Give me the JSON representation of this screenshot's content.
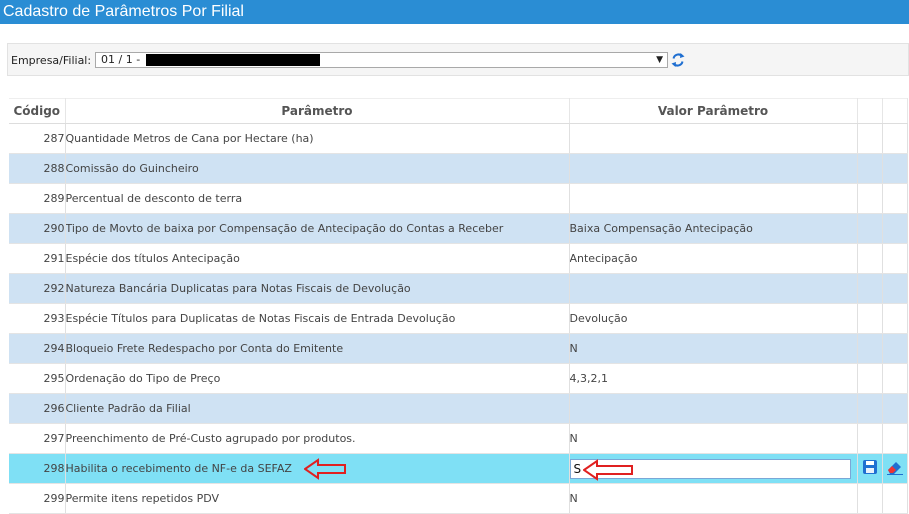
{
  "title": "Cadastro de Parâmetros Por Filial",
  "filter": {
    "label": "Empresa/Filial:",
    "selected_prefix": "01 / 1 -"
  },
  "table": {
    "headers": [
      "Código",
      "Parâmetro",
      "Valor Parâmetro"
    ],
    "rows": [
      {
        "code": "287",
        "param": "Quantidade Metros de Cana por Hectare (ha)",
        "value": ""
      },
      {
        "code": "288",
        "param": "Comissão do Guincheiro",
        "value": ""
      },
      {
        "code": "289",
        "param": "Percentual de desconto de terra",
        "value": ""
      },
      {
        "code": "290",
        "param": "Tipo de Movto de baixa por Compensação de Antecipação do Contas a Receber",
        "value": "Baixa Compensação Antecipação"
      },
      {
        "code": "291",
        "param": "Espécie dos títulos Antecipação",
        "value": "Antecipação"
      },
      {
        "code": "292",
        "param": "Natureza Bancária Duplicatas para Notas Fiscais de Devolução",
        "value": ""
      },
      {
        "code": "293",
        "param": "Espécie Títulos para Duplicatas de Notas Fiscais de Entrada Devolução",
        "value": "Devolução"
      },
      {
        "code": "294",
        "param": "Bloqueio Frete Redespacho por Conta do Emitente",
        "value": "N"
      },
      {
        "code": "295",
        "param": "Ordenação do Tipo de Preço",
        "value": "4,3,2,1"
      },
      {
        "code": "296",
        "param": "Cliente Padrão da Filial",
        "value": ""
      },
      {
        "code": "297",
        "param": "Preenchimento de Pré-Custo agrupado por produtos.",
        "value": "N"
      },
      {
        "code": "298",
        "param": "Habilita o recebimento de NF-e da SEFAZ",
        "value": "S"
      },
      {
        "code": "299",
        "param": "Permite itens repetidos PDV",
        "value": "N"
      }
    ]
  },
  "colors": {
    "titlebar": "#2a8dd4",
    "row_alt": "#cfe2f3",
    "row_editing": "#7fe0f5",
    "annotation_arrow": "#e02020"
  },
  "icons": {
    "refresh": "refresh-icon",
    "save": "save-icon",
    "clear": "eraser-icon"
  }
}
